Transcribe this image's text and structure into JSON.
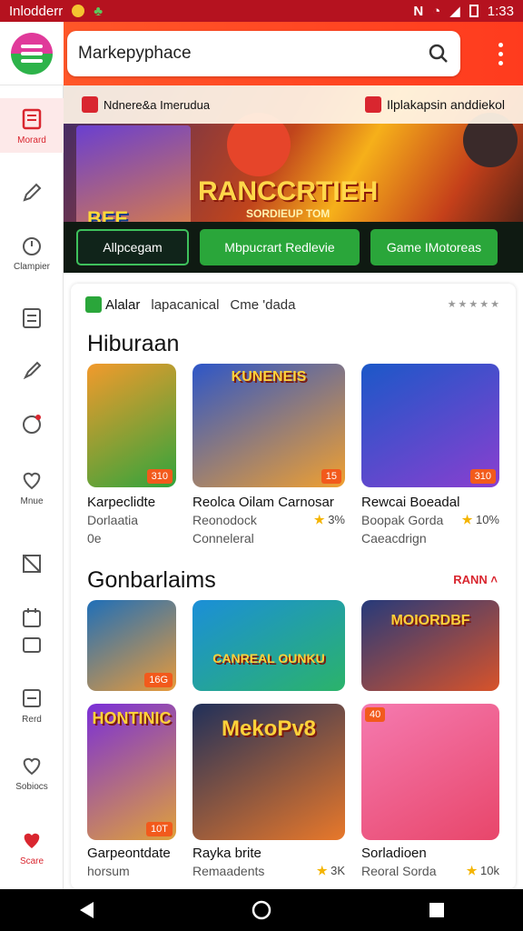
{
  "status_bar": {
    "left_text": "Inlodderr",
    "right_text": "N",
    "time": "1:33"
  },
  "search": {
    "placeholder": "Markepyphace"
  },
  "sidebar": {
    "items": [
      {
        "label": "Morard",
        "icon": "news-icon",
        "active": true
      },
      {
        "label": "",
        "icon": "pen-icon"
      },
      {
        "label": "Clampier",
        "icon": "clock-icon"
      },
      {
        "label": "",
        "icon": "list-icon"
      },
      {
        "label": "",
        "icon": "brush-icon"
      },
      {
        "label": "",
        "icon": "chat-icon"
      },
      {
        "label": "Mnue",
        "icon": "heart-icon"
      },
      {
        "label": "",
        "icon": "tag-icon"
      },
      {
        "label": "",
        "icon": "calendar-icon"
      },
      {
        "label": "Rerd",
        "icon": "message-icon"
      },
      {
        "label": "Sobiocs",
        "icon": "heart-outline-icon"
      },
      {
        "label": "Scare",
        "icon": "heart-filled-icon"
      }
    ]
  },
  "hero": {
    "top_left": "Ndnere&a Imerudua",
    "top_right": "Ilplakapsin anddiekol",
    "left_title": "BEE NADNO",
    "main_title": "RANCCRTIEH",
    "main_subtitle": "SORDIEUP TOM",
    "buttons": [
      "Allpcegam",
      "Mbpucrart Redlevie",
      "Game IMotoreas"
    ]
  },
  "tabs": {
    "items": [
      "Alalar",
      "lapacanical",
      "Cme 'dada"
    ],
    "rating": "★★★★★"
  },
  "sections": [
    {
      "title": "Hiburaan",
      "more": "",
      "cards": [
        {
          "name": "Karpeclidte",
          "line2": "Dorlaatia",
          "line3": "0e",
          "rating": "",
          "tag": "310",
          "art": "",
          "colors": [
            "#f29a2c",
            "#31a43c"
          ]
        },
        {
          "name": "Reolca Oilam Carnosar",
          "line2": "Reonodock",
          "line3": "Conneleral",
          "rating": "3%",
          "tag": "15",
          "art": "KUNENEIS",
          "colors": [
            "#2d56c8",
            "#f0a030"
          ]
        },
        {
          "name": "Rewcai Boeadal",
          "line2": "Boopak Gorda",
          "line3": "Caeacdrign",
          "rating": "10%",
          "tag": "310",
          "art": "",
          "colors": [
            "#1b58c8",
            "#8a3fd0"
          ]
        }
      ]
    },
    {
      "title": "Gonbarlaims",
      "more": "RANN",
      "cards": [
        {
          "name": "",
          "line2": "",
          "line3": "",
          "rating": "",
          "tag": "16G",
          "art": "",
          "colors": [
            "#1f6fb8",
            "#e89a3a"
          ]
        },
        {
          "name": "",
          "line2": "",
          "line3": "",
          "rating": "",
          "tag": "",
          "art": "CANREAL OUNKU",
          "colors": [
            "#1b8fd8",
            "#2bb36a"
          ]
        },
        {
          "name": "",
          "line2": "",
          "line3": "",
          "rating": "",
          "tag": "",
          "art": "MOIORDBF",
          "colors": [
            "#263a7a",
            "#d8532a"
          ]
        },
        {
          "name": "Garpeontdate",
          "line2": "horsum",
          "line3": "",
          "rating": "",
          "tag": "10T",
          "art": "HONTINIC",
          "colors": [
            "#7a2fd8",
            "#e0a13a"
          ]
        },
        {
          "name": "Rayka brite",
          "line2": "Remaadents",
          "line3": "",
          "rating": "3K",
          "tag": "",
          "art": "MekoPv8",
          "colors": [
            "#20305a",
            "#e8782a"
          ]
        },
        {
          "name": "Sorladioen",
          "line2": "Reoral Sorda",
          "line3": "",
          "rating": "10k",
          "tag": "40",
          "art": "",
          "colors": [
            "#f57ab0",
            "#e8466a"
          ]
        }
      ]
    }
  ],
  "colors": {
    "accent": "#d9262f",
    "topbar": "#ff4a22",
    "green": "#2aa63a"
  }
}
